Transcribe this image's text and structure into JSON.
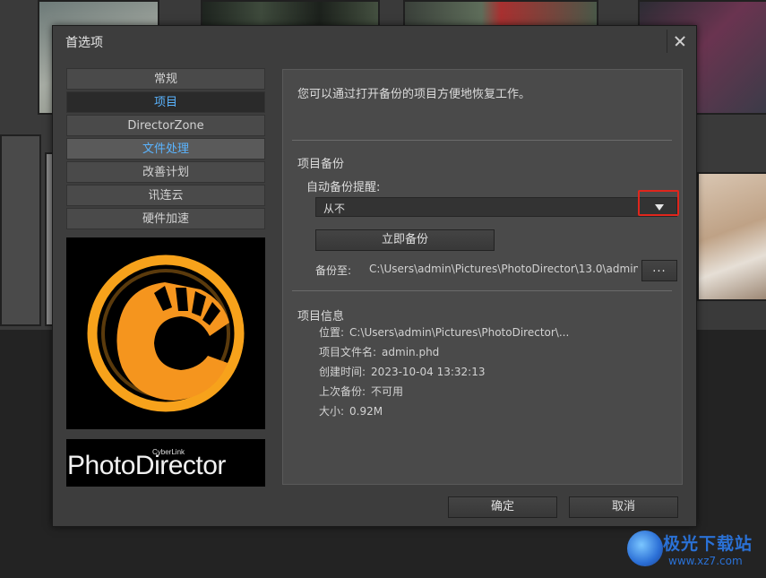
{
  "dialog": {
    "title": "首选项",
    "sidebar": [
      {
        "label": "常规"
      },
      {
        "label": "项目"
      },
      {
        "label": "DirectorZone"
      },
      {
        "label": "文件处理"
      },
      {
        "label": "改善计划"
      },
      {
        "label": "讯连云"
      },
      {
        "label": "硬件加速"
      }
    ],
    "brand": {
      "small": "CyberLink",
      "big": "PhotoDirector"
    },
    "description": "您可以通过打开备份的项目方便地恢复工作。",
    "backup": {
      "section_title": "项目备份",
      "auto_label": "自动备份提醒:",
      "auto_value": "从不",
      "backup_now": "立即备份",
      "path_label": "备份至:",
      "path_value": "C:\\Users\\admin\\Pictures\\PhotoDirector\\13.0\\admin",
      "browse": "..."
    },
    "info": {
      "section_title": "项目信息",
      "rows": [
        {
          "key": "位置:",
          "value": "C:\\Users\\admin\\Pictures\\PhotoDirector\\..."
        },
        {
          "key": "项目文件名:",
          "value": "admin.phd"
        },
        {
          "key": "创建时间:",
          "value": "2023-10-04 13:32:13"
        },
        {
          "key": "上次备份:",
          "value": "不可用"
        },
        {
          "key": "大小:",
          "value": "0.92M"
        }
      ]
    },
    "ok": "确定",
    "cancel": "取消"
  },
  "watermark": {
    "title": "极光下载站",
    "url": "www.xz7.com"
  },
  "colors": {
    "accent_text": "#5ab4ff",
    "highlight_box": "#e0261c",
    "logo_orange": "#f7a21b"
  }
}
